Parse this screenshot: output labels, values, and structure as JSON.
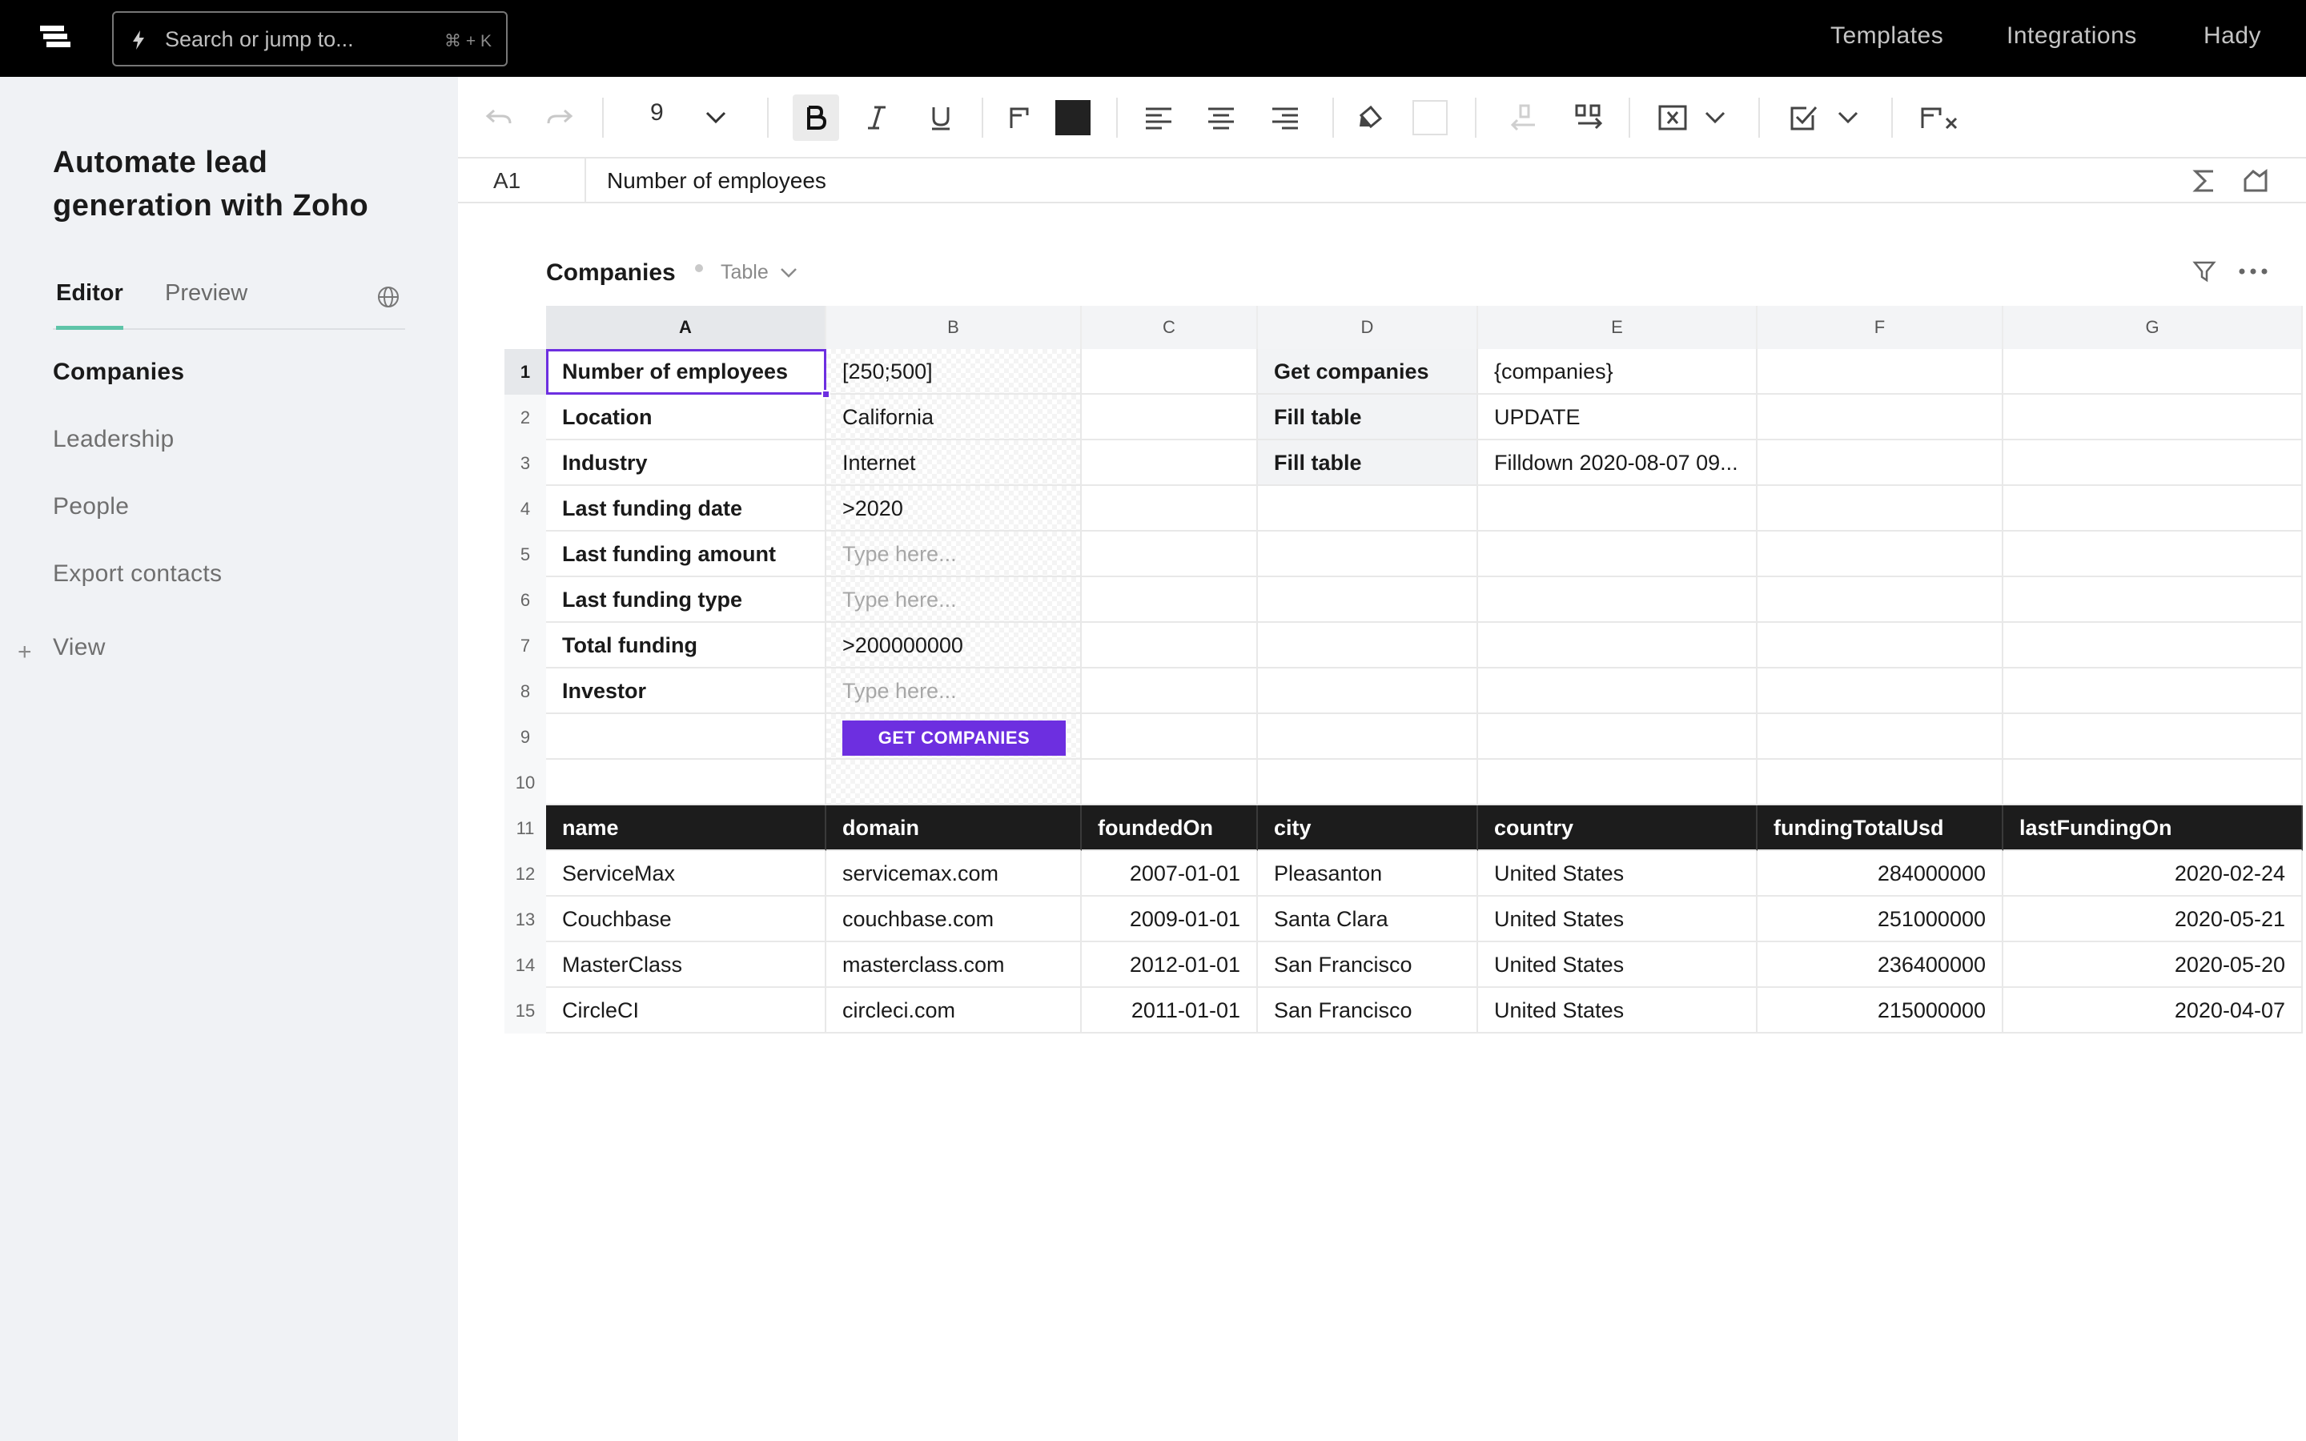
{
  "topbar": {
    "search_placeholder": "Search or jump to...",
    "search_shortcut": "⌘ + K",
    "nav": [
      "Templates",
      "Integrations",
      "Hady"
    ]
  },
  "sidebar": {
    "title": "Automate lead generation with Zoho",
    "tabs": [
      "Editor",
      "Preview"
    ],
    "items": [
      "Companies",
      "Leadership",
      "People",
      "Export contacts"
    ],
    "add_view": "View"
  },
  "toolbar": {
    "font_size": "9",
    "colors": {
      "text": "#222222",
      "fill": "#ffffff",
      "accent": "#6d2fe0"
    }
  },
  "formula_bar": {
    "cell_ref": "A1",
    "value": "Number of employees"
  },
  "table": {
    "title": "Companies",
    "type_label": "Table",
    "columns": [
      "A",
      "B",
      "C",
      "D",
      "E",
      "F",
      "G"
    ],
    "rows": [
      "1",
      "2",
      "3",
      "4",
      "5",
      "6",
      "7",
      "8",
      "9",
      "10",
      "11",
      "12",
      "13",
      "14",
      "15"
    ],
    "params": [
      {
        "label": "Number of employees",
        "value": "[250;500]"
      },
      {
        "label": "Location",
        "value": "California"
      },
      {
        "label": "Industry",
        "value": "Internet"
      },
      {
        "label": "Last funding date",
        "value": ">2020"
      },
      {
        "label": "Last funding amount",
        "value": "Type here..."
      },
      {
        "label": "Last funding type",
        "value": "Type here..."
      },
      {
        "label": "Total funding",
        "value": ">200000000"
      },
      {
        "label": "Investor",
        "value": "Type here..."
      }
    ],
    "get_button": "GET COMPANIES",
    "actions": [
      {
        "label": "Get companies",
        "value": "{companies}"
      },
      {
        "label": "Fill table",
        "value": "UPDATE"
      },
      {
        "label": "Fill table",
        "value": "Filldown 2020-08-07 09..."
      }
    ],
    "headers": [
      "name",
      "domain",
      "foundedOn",
      "city",
      "country",
      "fundingTotalUsd",
      "lastFundingOn"
    ],
    "data": [
      [
        "ServiceMax",
        "servicemax.com",
        "2007-01-01",
        "Pleasanton",
        "United States",
        "284000000",
        "2020-02-24"
      ],
      [
        "Couchbase",
        "couchbase.com",
        "2009-01-01",
        "Santa Clara",
        "United States",
        "251000000",
        "2020-05-21"
      ],
      [
        "MasterClass",
        "masterclass.com",
        "2012-01-01",
        "San Francisco",
        "United States",
        "236400000",
        "2020-05-20"
      ],
      [
        "CircleCI",
        "circleci.com",
        "2011-01-01",
        "San Francisco",
        "United States",
        "215000000",
        "2020-04-07"
      ]
    ]
  }
}
